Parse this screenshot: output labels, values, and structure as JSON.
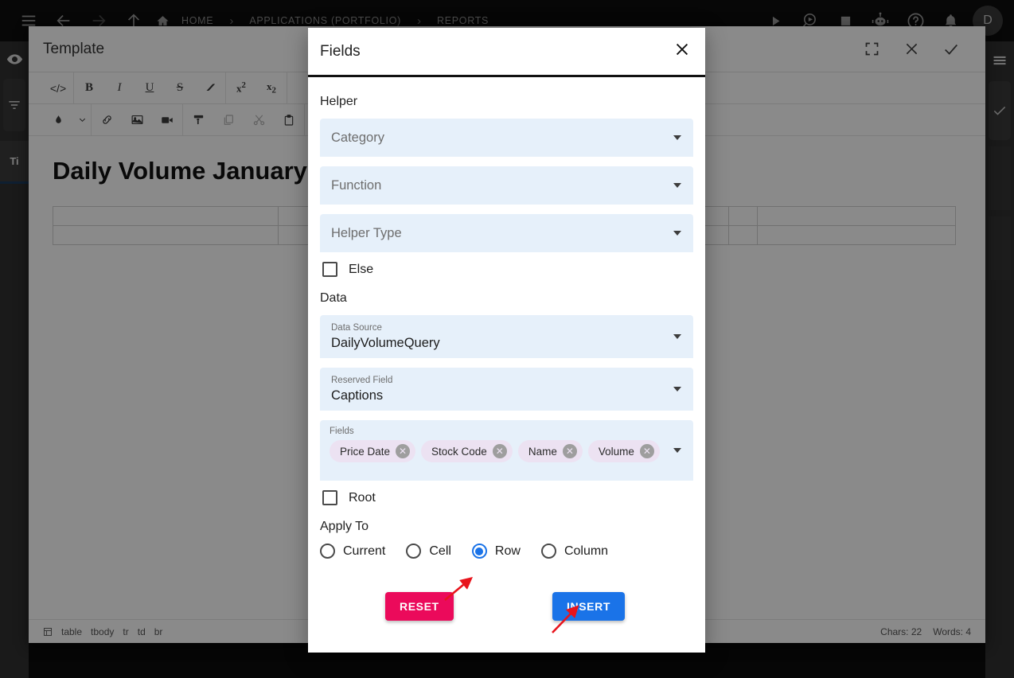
{
  "topbar": {
    "menu_icon": "hamburger-icon",
    "back_icon": "arrow-left-icon",
    "forward_icon": "arrow-right-icon",
    "up_icon": "arrow-up-icon",
    "home_icon": "home-icon",
    "breadcrumbs": [
      {
        "label": "HOME"
      },
      {
        "label": "APPLICATIONS (PORTFOLIO)"
      },
      {
        "label": "REPORTS"
      }
    ],
    "separator": "›",
    "actions": [
      {
        "name": "run-icon"
      },
      {
        "name": "search-preview-icon"
      },
      {
        "name": "stop-icon"
      },
      {
        "name": "chat-bot-icon"
      },
      {
        "name": "help-icon"
      },
      {
        "name": "notifications-icon"
      }
    ],
    "avatar_initial": "D"
  },
  "editor": {
    "title": "Template",
    "header_actions": [
      {
        "name": "fullscreen-icon"
      },
      {
        "name": "close-icon"
      },
      {
        "name": "confirm-icon"
      }
    ],
    "toolbar_row1": [
      {
        "name": "source-code-icon",
        "glyph": "</>"
      },
      {
        "name": "bold-icon",
        "glyph": "B"
      },
      {
        "name": "italic-icon",
        "glyph": "I"
      },
      {
        "name": "underline-icon",
        "glyph": "U"
      },
      {
        "name": "strikethrough-icon",
        "glyph": "S"
      },
      {
        "name": "clear-format-icon",
        "glyph": "▱"
      },
      {
        "name": "superscript-icon",
        "glyph": "x²"
      },
      {
        "name": "subscript-icon",
        "glyph": "x₂"
      }
    ],
    "toolbar_row2": [
      {
        "name": "text-color-icon"
      },
      {
        "name": "color-dropdown-icon"
      },
      {
        "name": "link-icon"
      },
      {
        "name": "image-icon"
      },
      {
        "name": "video-icon"
      },
      {
        "name": "format-painter-icon"
      },
      {
        "name": "copy-icon"
      },
      {
        "name": "cut-icon"
      },
      {
        "name": "paste-icon"
      },
      {
        "name": "delete-icon"
      }
    ],
    "document": {
      "heading": "Daily Volume January",
      "table_rows": 2,
      "table_cols": 5
    },
    "status": {
      "path": [
        "table",
        "tbody",
        "tr",
        "td",
        "br"
      ],
      "path_icon": "element-path-icon",
      "chars": "Chars: 22",
      "words": "Words: 4"
    }
  },
  "modal": {
    "title": "Fields",
    "close_icon": "close-icon",
    "helper_section": {
      "label": "Helper",
      "selects": [
        {
          "name": "category-select",
          "placeholder": "Category",
          "value": ""
        },
        {
          "name": "function-select",
          "placeholder": "Function",
          "value": ""
        },
        {
          "name": "helper-type-select",
          "placeholder": "Helper Type",
          "value": ""
        }
      ],
      "checkbox": {
        "label": "Else",
        "checked": false
      }
    },
    "data_section": {
      "label": "Data",
      "data_source": {
        "label": "Data Source",
        "value": "DailyVolumeQuery"
      },
      "reserved_field": {
        "label": "Reserved Field",
        "value": "Captions"
      },
      "fields": {
        "label": "Fields",
        "chips": [
          "Price Date",
          "Stock Code",
          "Name",
          "Volume"
        ],
        "remove_glyph": "✕"
      },
      "checkbox": {
        "label": "Root",
        "checked": false
      }
    },
    "apply_to": {
      "label": "Apply To",
      "options": [
        {
          "label": "Current",
          "selected": false
        },
        {
          "label": "Cell",
          "selected": false
        },
        {
          "label": "Row",
          "selected": true
        },
        {
          "label": "Column",
          "selected": false
        }
      ]
    },
    "buttons": {
      "reset": "RESET",
      "insert": "INSERT"
    }
  },
  "annotations": {
    "arrow_color": "#e8141c",
    "arrows": [
      {
        "name": "arrow-to-row-radio"
      },
      {
        "name": "arrow-to-insert-button"
      }
    ]
  },
  "colors": {
    "accent_blue": "#1a73e8",
    "reset_pink": "#eb0a5b",
    "field_bg": "#e6f0fa",
    "chip_bg": "#ece2f2",
    "topbar_bg": "#0d0d0d"
  }
}
